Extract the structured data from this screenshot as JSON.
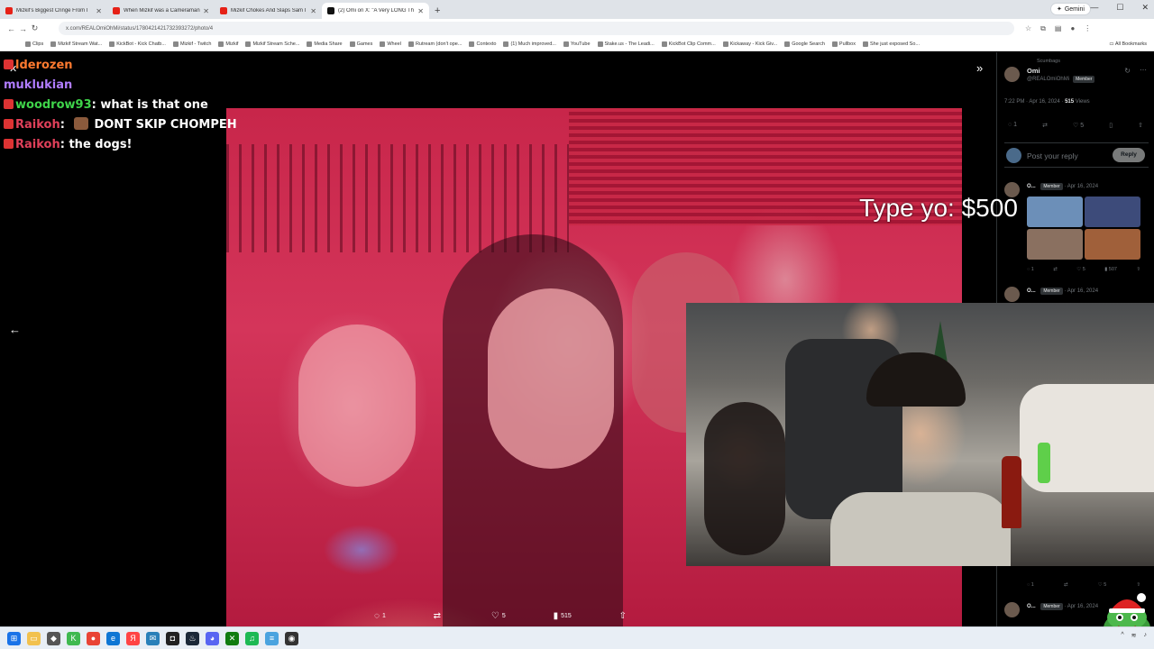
{
  "browser": {
    "tabs": [
      {
        "title": "Mizkif's Biggest Cringe From I",
        "active": false,
        "icon": "youtube-icon"
      },
      {
        "title": "When Mizkif was a Cameraman",
        "active": false,
        "icon": "youtube-icon"
      },
      {
        "title": "Mizkif Chokes And Slaps Sam I",
        "active": false,
        "icon": "youtube-icon"
      },
      {
        "title": "(2) Omi on X: \"A Very LONG Th",
        "active": true,
        "icon": "x-icon"
      }
    ],
    "new_tab_label": "+",
    "gemini_label": "Gemini",
    "url": "x.com/REALOmiOhMi/status/1780421421732393272/photo/4",
    "bookmarks": [
      "Clips",
      "Mizkif Stream Wat...",
      "KickBot - Kick Chatb...",
      "Mizkif - Twitch",
      "Mizkif",
      "Mizkif Stream Sche...",
      "Media Share",
      "Games",
      "Wheel",
      "Rutream (don't ope...",
      "Contexto",
      "(1) Much improved...",
      "YouTube",
      "Stake.us - The Leadi...",
      "KickBot Clip Comm...",
      "Kickaway - Kick Giv...",
      "Google Search",
      "Pullbox",
      "She just exposed So..."
    ],
    "all_bookmarks_label": "All Bookmarks"
  },
  "chat": [
    {
      "user": "lderozen",
      "message": "",
      "color": "orange"
    },
    {
      "user": "muklukian",
      "message": "",
      "color": "purple"
    },
    {
      "user": "woodrow93",
      "message": "what is that one",
      "color": "green"
    },
    {
      "user": "Raikoh",
      "message": "DONT SKIP CHOMPEH",
      "color": "red",
      "emote": true
    },
    {
      "user": "Raikoh",
      "message": "the dogs!",
      "color": "red"
    }
  ],
  "photo_actions": {
    "replies": "1",
    "retweets": "",
    "likes": "5",
    "views": "515"
  },
  "overlay": {
    "text": "Type yo: $500"
  },
  "x_sidebar": {
    "community": "Scumbags",
    "name": "Omi",
    "handle": "@REALOmiOhMi",
    "member_badge": "Member",
    "time": "7:22 PM · Apr 16, 2024",
    "views_count": "515",
    "views_label": "Views",
    "reply_count": "1",
    "like_count": "5",
    "reply_placeholder": "Post your reply",
    "reply_button": "Reply",
    "replies": [
      {
        "name": "O...",
        "badge": "Member",
        "date": "Apr 16, 2024",
        "replies": "1",
        "likes": "5",
        "views": "507"
      },
      {
        "name": "O...",
        "badge": "Member",
        "date": "Apr 16, 2024"
      },
      {
        "name": "O...",
        "badge": "Member",
        "date": "Apr 16, 2024",
        "replies": "1",
        "likes": "5"
      },
      {
        "name": "O...",
        "badge": "Member",
        "date": "Apr 16, 2024"
      }
    ]
  },
  "taskbar": {
    "apps": [
      "start",
      "search",
      "widgets",
      "files",
      "store",
      "chrome",
      "edge",
      "yandex",
      "slack",
      "epic",
      "steam",
      "discord",
      "xbox",
      "spotify",
      "notepad",
      "obs"
    ]
  }
}
